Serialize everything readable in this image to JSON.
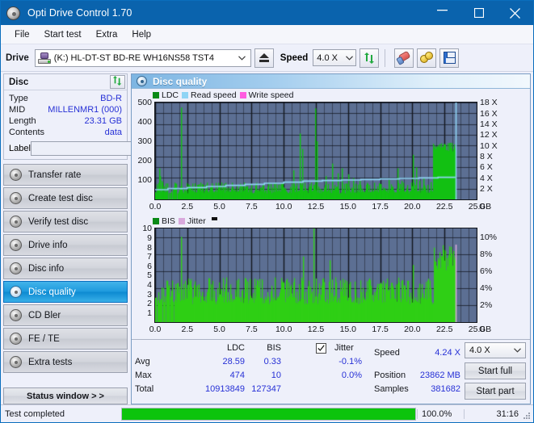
{
  "window": {
    "title": "Opti Drive Control 1.70",
    "icon": "disc-icon",
    "minimize": "─",
    "maximize": "□",
    "close": "✕"
  },
  "menubar": {
    "items": [
      "File",
      "Start test",
      "Extra",
      "Help"
    ]
  },
  "toolbar": {
    "drive_label": "Drive",
    "drive_value": "(K:)  HL-DT-ST BD-RE  WH16NS58 TST4",
    "eject_icon": "eject-icon",
    "speed_label": "Speed",
    "speed_value": "4.0 X",
    "refresh_icon": "refresh-icon",
    "eraser_icon": "eraser-icon",
    "coins_icon": "coins-icon",
    "save_icon": "floppy-disk-icon"
  },
  "disc_panel": {
    "title": "Disc",
    "refresh_icon": "refresh-icon",
    "rows": [
      {
        "key": "Type",
        "value": "BD-R"
      },
      {
        "key": "MID",
        "value": "MILLENMR1 (000)"
      },
      {
        "key": "Length",
        "value": "23.31 GB"
      },
      {
        "key": "Contents",
        "value": "data"
      }
    ],
    "label_key": "Label",
    "label_value": "",
    "label_placeholder": "",
    "disc_icon": "cd-icon"
  },
  "sidebar": {
    "items": [
      {
        "label": "Transfer rate",
        "icon": "disc-test-icon",
        "active": false
      },
      {
        "label": "Create test disc",
        "icon": "disc-test-icon",
        "active": false
      },
      {
        "label": "Verify test disc",
        "icon": "disc-test-icon",
        "active": false
      },
      {
        "label": "Drive info",
        "icon": "disc-test-icon",
        "active": false
      },
      {
        "label": "Disc info",
        "icon": "disc-test-icon",
        "active": false
      },
      {
        "label": "Disc quality",
        "icon": "disc-test-icon",
        "active": true
      },
      {
        "label": "CD Bler",
        "icon": "disc-test-icon",
        "active": false
      },
      {
        "label": "FE / TE",
        "icon": "disc-test-icon",
        "active": false
      },
      {
        "label": "Extra tests",
        "icon": "disc-test-icon",
        "active": false
      }
    ],
    "status_button": "Status window > >"
  },
  "main": {
    "title": "Disc quality",
    "icon": "disc-quality-icon"
  },
  "stats": {
    "col_headers": [
      "LDC",
      "BIS"
    ],
    "row_labels": [
      "Avg",
      "Max",
      "Total"
    ],
    "ldc": {
      "avg": "28.59",
      "max": "474",
      "total": "10913849"
    },
    "bis": {
      "avg": "0.33",
      "max": "10",
      "total": "127347"
    },
    "jitter": {
      "label": "Jitter",
      "checked": true,
      "avg": "-0.1%",
      "max": "0.0%"
    },
    "speed_label": "Speed",
    "speed_value": "4.24 X",
    "position_label": "Position",
    "position_value": "23862 MB",
    "samples_label": "Samples",
    "samples_value": "381682",
    "speed_select": "4.0 X",
    "start_full": "Start full",
    "start_part": "Start part"
  },
  "statusbar": {
    "text": "Test completed",
    "progress_percent": 100.0,
    "progress_label": "100.0%",
    "elapsed": "31:16"
  },
  "colors": {
    "accent": "#0a63ad",
    "plot_bg": "#5c6f93",
    "grid": "#12151c",
    "ldc_green": "#12c012",
    "bis_green": "#2fcf15",
    "read_speed": "#8fd4f5",
    "write_speed": "#ff5ce0",
    "jitter": "#d9a9dd",
    "value_blue": "#2731d6",
    "progress_green": "#0cc40c"
  },
  "chart_data": [
    {
      "type": "area",
      "name": "ldc-chart",
      "title": "",
      "xlabel": "GB",
      "ylabel": "",
      "legend": [
        {
          "label": "LDC",
          "color": "#12c012"
        },
        {
          "label": "Read speed",
          "color": "#8fd4f5"
        },
        {
          "label": "Write speed",
          "color": "#ff5ce0"
        }
      ],
      "legend_position": "top-left",
      "grid": true,
      "xlim": [
        0.0,
        25.0
      ],
      "xticks": [
        0.0,
        2.5,
        5.0,
        7.5,
        10.0,
        12.5,
        15.0,
        17.5,
        20.0,
        22.5,
        25.0
      ],
      "xticklabels": [
        "0.0",
        "2.5",
        "5.0",
        "7.5",
        "10.0",
        "12.5",
        "15.0",
        "17.5",
        "20.0",
        "22.5",
        "25.0"
      ],
      "ylim": [
        0,
        500
      ],
      "yticks": [
        100,
        200,
        300,
        400,
        500
      ],
      "yticklabels": [
        "100",
        "200",
        "300",
        "400",
        "500"
      ],
      "y2lim": [
        0,
        18
      ],
      "y2ticks": [
        2,
        4,
        6,
        8,
        10,
        12,
        14,
        16,
        18
      ],
      "y2ticklabels": [
        "2 X",
        "4 X",
        "6 X",
        "8 X",
        "10 X",
        "12 X",
        "14 X",
        "16 X",
        "18 X"
      ],
      "data_end_x": 23.4,
      "series": [
        {
          "name": "LDC",
          "color": "#12c012",
          "type": "spike-area",
          "baseline": 30,
          "noise": 18,
          "spikes": [
            [
              0.35,
              160
            ],
            [
              0.42,
              120
            ],
            [
              0.55,
              95
            ],
            [
              2.05,
              474
            ],
            [
              3.95,
              75
            ],
            [
              4.4,
              70
            ],
            [
              10.8,
              150
            ],
            [
              11.3,
              340
            ],
            [
              11.45,
              260
            ],
            [
              12.45,
              470
            ],
            [
              12.6,
              300
            ],
            [
              13.3,
              120
            ],
            [
              13.8,
              185
            ],
            [
              14.2,
              135
            ],
            [
              14.55,
              160
            ],
            [
              15.05,
              130
            ],
            [
              15.4,
              110
            ],
            [
              15.9,
              95
            ],
            [
              17.5,
              80
            ],
            [
              18.2,
              100
            ],
            [
              18.9,
              160
            ],
            [
              19.2,
              95
            ],
            [
              20.05,
              230
            ],
            [
              20.35,
              165
            ],
            [
              20.6,
              95
            ],
            [
              20.9,
              110
            ],
            [
              21.2,
              75
            ],
            [
              21.45,
              90
            ]
          ],
          "plateau": {
            "from": 21.6,
            "to": 23.35,
            "level": 270,
            "variation": 45
          }
        },
        {
          "name": "Read speed",
          "color": "#8fd4f5",
          "type": "step-line",
          "axis": "right",
          "points": [
            [
              0.0,
              1.8
            ],
            [
              1.0,
              2.0
            ],
            [
              2.5,
              2.2
            ],
            [
              4.0,
              2.4
            ],
            [
              5.5,
              2.6
            ],
            [
              7.0,
              2.8
            ],
            [
              8.5,
              3.0
            ],
            [
              10.0,
              3.2
            ],
            [
              11.5,
              3.4
            ],
            [
              13.0,
              3.5
            ],
            [
              14.5,
              3.6
            ],
            [
              16.0,
              3.7
            ],
            [
              17.5,
              3.8
            ],
            [
              19.0,
              3.9
            ],
            [
              20.5,
              4.0
            ],
            [
              22.0,
              4.1
            ],
            [
              23.35,
              4.1
            ]
          ],
          "end_marker": {
            "x": 23.4,
            "from": 0,
            "to": 18
          }
        },
        {
          "name": "Write speed",
          "color": "#ff5ce0",
          "type": "step-line",
          "axis": "right",
          "points": []
        }
      ]
    },
    {
      "type": "area",
      "name": "bis-chart",
      "title": "",
      "xlabel": "GB",
      "ylabel": "",
      "legend": [
        {
          "label": "BIS",
          "color": "#2fcf15"
        },
        {
          "label": "Jitter",
          "color": "#d9a9dd"
        }
      ],
      "legend_position": "top-left",
      "grid": true,
      "xlim": [
        0.0,
        25.0
      ],
      "xticks": [
        0.0,
        2.5,
        5.0,
        7.5,
        10.0,
        12.5,
        15.0,
        17.5,
        20.0,
        22.5,
        25.0
      ],
      "xticklabels": [
        "0.0",
        "2.5",
        "5.0",
        "7.5",
        "10.0",
        "12.5",
        "15.0",
        "17.5",
        "20.0",
        "22.5",
        "25.0"
      ],
      "ylim": [
        0,
        10
      ],
      "yticks": [
        1,
        2,
        3,
        4,
        5,
        6,
        7,
        8,
        9,
        10
      ],
      "yticklabels": [
        "1",
        "2",
        "3",
        "4",
        "5",
        "6",
        "7",
        "8",
        "9",
        "10"
      ],
      "y2lim": [
        0,
        11
      ],
      "y2ticks": [
        2,
        4,
        6,
        8,
        10
      ],
      "y2ticklabels": [
        "2%",
        "4%",
        "6%",
        "8%",
        "10%"
      ],
      "data_end_x": 23.4,
      "series": [
        {
          "name": "BIS",
          "color": "#2fcf15",
          "type": "spike-area",
          "baseline": 1.9,
          "noise": 0.9,
          "spikes": [
            [
              2.05,
              9.1
            ],
            [
              2.6,
              4.2
            ],
            [
              11.55,
              7.0
            ],
            [
              12.35,
              10.0
            ],
            [
              13.6,
              6.6
            ],
            [
              15.2,
              4.3
            ],
            [
              17.6,
              4.1
            ],
            [
              19.6,
              4.2
            ],
            [
              20.1,
              6.1
            ],
            [
              20.55,
              4.1
            ]
          ],
          "plateau": {
            "from": 21.65,
            "to": 23.35,
            "level": 6.8,
            "variation": 2.9
          }
        },
        {
          "name": "Jitter",
          "color": "#d9a9dd",
          "type": "line",
          "axis": "right",
          "points": [],
          "end_marker": {
            "x": 23.4,
            "from": 0,
            "to": 9.1
          }
        }
      ]
    }
  ]
}
